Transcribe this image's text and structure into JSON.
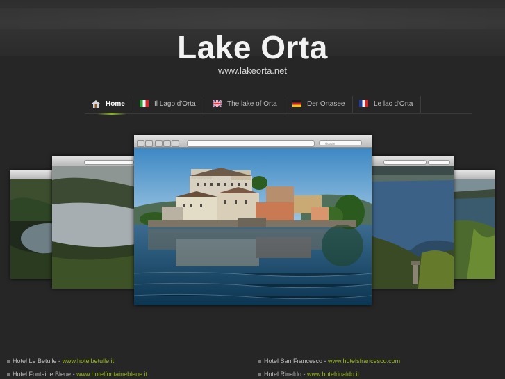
{
  "header": {
    "title": "Lake Orta",
    "url": "www.lakeorta.net"
  },
  "nav": {
    "items": [
      {
        "label": "Home",
        "icon": "home-icon",
        "active": true
      },
      {
        "label": "Il Lago d'Orta",
        "icon": "italian-flag-icon"
      },
      {
        "label": "The lake of Orta",
        "icon": "uk-flag-icon"
      },
      {
        "label": "Der Ortasee",
        "icon": "german-flag-icon"
      },
      {
        "label": "Le lac d'Orta",
        "icon": "french-flag-icon"
      }
    ]
  },
  "slideshow": {
    "search_placeholder": "Google"
  },
  "footer": {
    "hotels": [
      {
        "name": "Hotel Le Betulle",
        "sep": " - ",
        "link": "www.hotelbetulle.it"
      },
      {
        "name": "Hotel Fontaine Bleue",
        "sep": " - ",
        "link": "www.hotelfontainebleue.it"
      },
      {
        "name": "Hotel San Francesco",
        "sep": " - ",
        "link": "www.hotelsfrancesco.com"
      },
      {
        "name": "Hotel Rinaldo",
        "sep": " - ",
        "link": "www.hotelrinaldo.it"
      }
    ]
  },
  "colors": {
    "background": "#262626",
    "accent": "#9ab82c",
    "title": "#f2f2f2"
  }
}
